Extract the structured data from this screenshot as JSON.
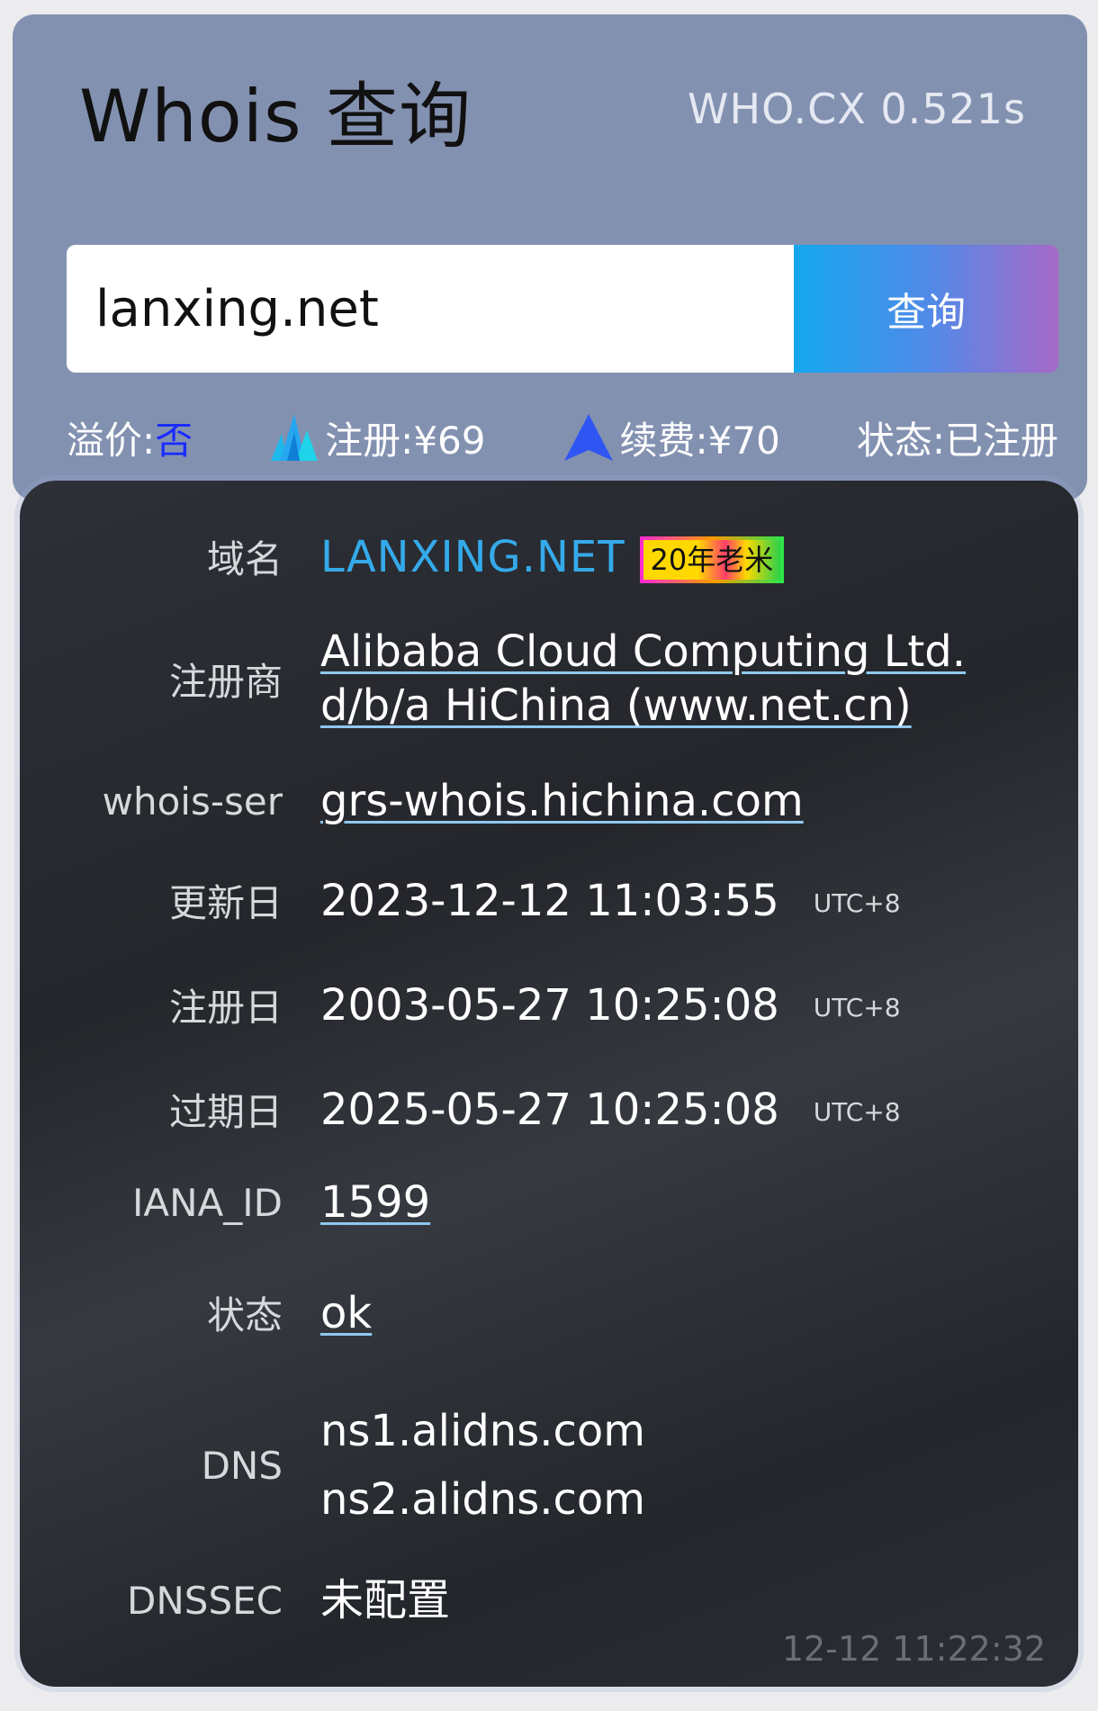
{
  "header": {
    "title": "Whois 查询",
    "timing": "WHO.CX 0.521s"
  },
  "search": {
    "value": "lanxing.net",
    "button_label": "查询"
  },
  "info_bar": {
    "premium_label": "溢价:",
    "premium_value": "否",
    "register_label": "注册:¥69",
    "renew_label": "续费:¥70",
    "status_label": "状态:已注册"
  },
  "result": {
    "domain": {
      "label": "域名",
      "value": "LANXING.NET",
      "badge": "20年老米"
    },
    "registrar": {
      "label": "注册商",
      "value": "Alibaba Cloud Computing Ltd. d/b/a HiChina (www.net.cn)"
    },
    "whois_server": {
      "label": "whois-ser",
      "value": "grs-whois.hichina.com"
    },
    "updated": {
      "label": "更新日",
      "value": "2023-12-12 11:03:55",
      "tz": "UTC+8"
    },
    "created": {
      "label": "注册日",
      "value": "2003-05-27 10:25:08",
      "tz": "UTC+8"
    },
    "expires": {
      "label": "过期日",
      "value": "2025-05-27 10:25:08",
      "tz": "UTC+8"
    },
    "iana_id": {
      "label": "IANA_ID",
      "value": "1599"
    },
    "status": {
      "label": "状态",
      "value": "ok"
    },
    "dns": {
      "label": "DNS",
      "servers": [
        "ns1.alidns.com",
        "ns2.alidns.com"
      ]
    },
    "dnssec": {
      "label": "DNSSEC",
      "value": "未配置"
    },
    "query_time": "12-12 11:22:32"
  },
  "colors": {
    "header_bg": "#8391b1",
    "card_bg": "#2a2d32",
    "domain_color": "#35aaea",
    "premium_value_color": "#1a2cff"
  },
  "icons": {
    "register": "mountain-peaks-icon",
    "renew": "triangle-arrow-icon"
  }
}
